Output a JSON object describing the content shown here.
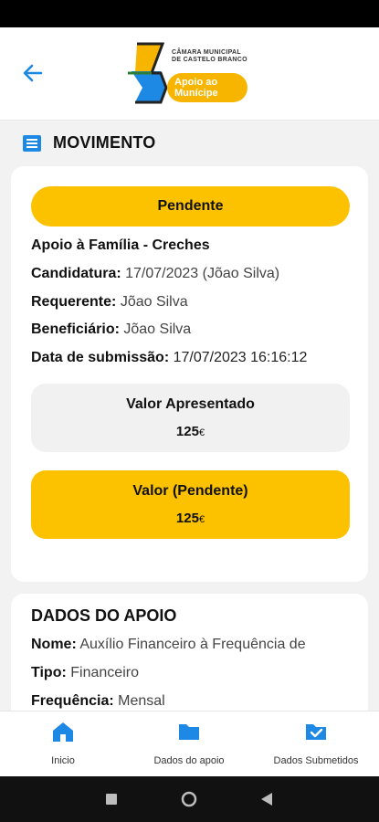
{
  "header": {
    "org_name_line1": "CÂMARA MUNICIPAL",
    "org_name_line2": "DE CASTELO BRANCO",
    "app_name_line1": "Apoio ao",
    "app_name_line2": "Munícipe"
  },
  "section": {
    "title": "MOVIMENTO"
  },
  "movimento": {
    "status": "Pendente",
    "tipo_apoio": "Apoio à Família - Creches",
    "candidatura_label": "Candidatura:",
    "candidatura_value": "17/07/2023 (Jõao Silva)",
    "requerente_label": "Requerente:",
    "requerente_value": "Jõao Silva",
    "beneficiario_label": "Beneficiário:",
    "beneficiario_value": "Jõao Silva",
    "data_label": "Data de submissão:",
    "data_value": "17/07/2023 16:16:12",
    "valor_apresentado_label": "Valor Apresentado",
    "valor_apresentado_amount": "125",
    "valor_pendente_label": "Valor (Pendente)",
    "valor_pendente_amount": "125",
    "currency": "€"
  },
  "dados_apoio": {
    "heading": "DADOS DO APOIO",
    "nome_label": "Nome:",
    "nome_value": "Auxílio Financeiro à Frequência de",
    "tipo_label": "Tipo:",
    "tipo_value": "Financeiro",
    "frequencia_label": "Frequência:",
    "frequencia_value": "Mensal"
  },
  "bottom_nav": [
    {
      "label": "Inicio",
      "icon": "home-icon"
    },
    {
      "label": "Dados do apoio",
      "icon": "folder-icon"
    },
    {
      "label": "Dados Submetidos",
      "icon": "folder-check-icon"
    }
  ],
  "colors": {
    "accent_blue": "#1e88e5",
    "status_yellow": "#fcc200"
  }
}
